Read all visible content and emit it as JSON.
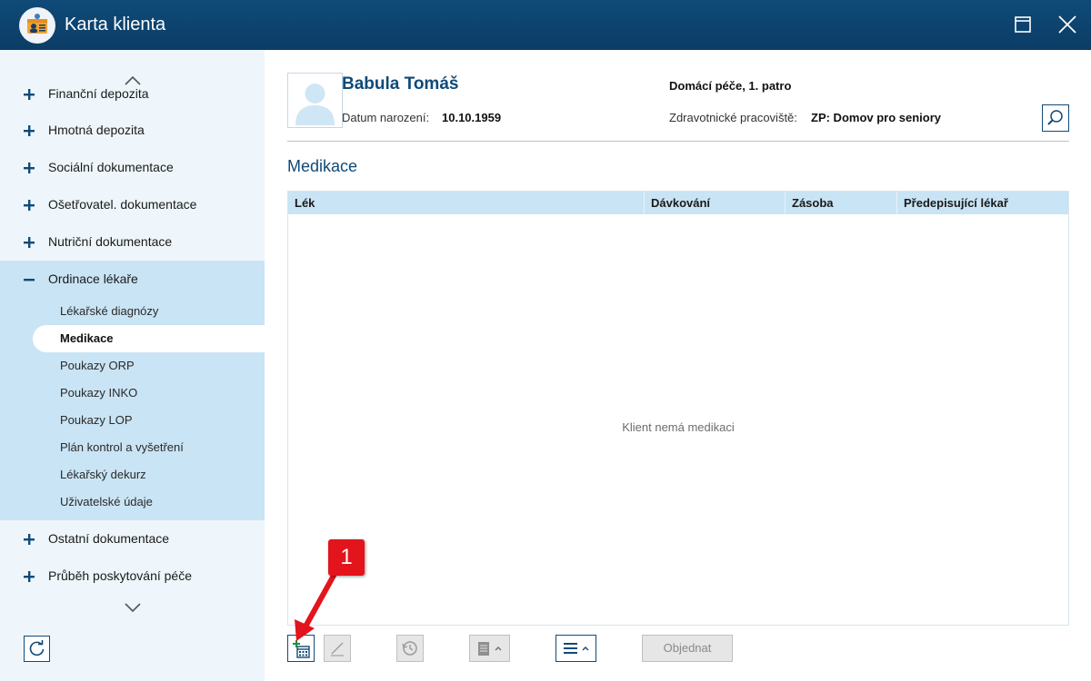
{
  "window": {
    "title": "Karta klienta"
  },
  "sidebar": {
    "items": [
      {
        "label": "Finanční depozita",
        "expanded": false
      },
      {
        "label": "Hmotná depozita",
        "expanded": false
      },
      {
        "label": "Sociální dokumentace",
        "expanded": false
      },
      {
        "label": "Ošetřovatel. dokumentace",
        "expanded": false
      },
      {
        "label": "Nutriční dokumentace",
        "expanded": false
      },
      {
        "label": "Ordinace lékaře",
        "expanded": true
      },
      {
        "label": "Ostatní dokumentace",
        "expanded": false
      },
      {
        "label": "Průběh poskytování péče",
        "expanded": false
      }
    ],
    "subitems": [
      {
        "label": "Lékařské diagnózy"
      },
      {
        "label": "Medikace",
        "active": true
      },
      {
        "label": "Poukazy ORP"
      },
      {
        "label": "Poukazy INKO"
      },
      {
        "label": "Poukazy LOP"
      },
      {
        "label": "Plán kontrol a vyšetření"
      },
      {
        "label": "Lékařský dekurz"
      },
      {
        "label": "Uživatelské údaje"
      }
    ]
  },
  "client": {
    "name": "Babula Tomáš",
    "birth_label": "Datum narození:",
    "birth_date": "10.10.1959",
    "room": "Domácí péče, 1. patro",
    "facility_label": "Zdravotnické pracoviště:",
    "facility": "ZP: Domov pro seniory"
  },
  "main": {
    "section_title": "Medikace",
    "table": {
      "columns": [
        "Lék",
        "Dávkování",
        "Zásoba",
        "Předepisující lékař"
      ],
      "rows": [],
      "empty_message": "Klient nemá medikaci"
    },
    "toolbar": {
      "order_label": "Objednat"
    }
  },
  "callout": {
    "number": "1"
  },
  "colors": {
    "titlebar": "#0f4a78",
    "accent": "#0f4a78",
    "sidebar_bg": "#eef6fb",
    "group_bg": "#c9e4f4",
    "table_header_bg": "#c9e4f4",
    "callout": "#e3141b"
  }
}
